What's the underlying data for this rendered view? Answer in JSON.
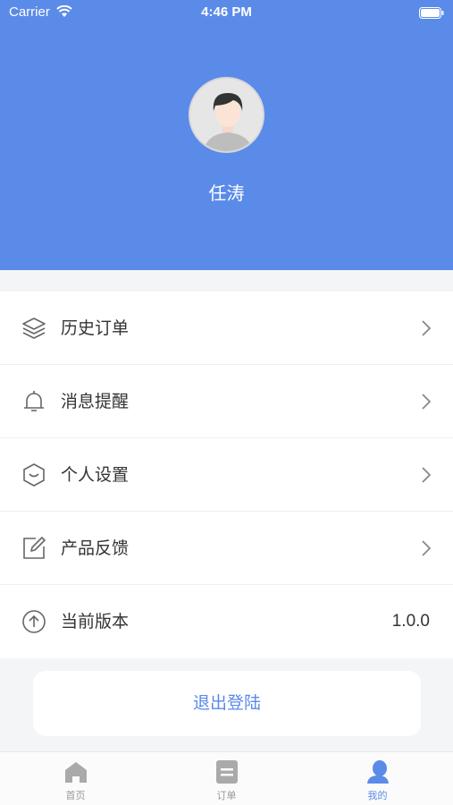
{
  "status_bar": {
    "carrier": "Carrier",
    "time": "4:46 PM"
  },
  "profile": {
    "name": "任涛"
  },
  "menu": [
    {
      "label": "历史订单",
      "icon": "layers-icon"
    },
    {
      "label": "消息提醒",
      "icon": "bell-icon"
    },
    {
      "label": "个人设置",
      "icon": "shield-icon"
    },
    {
      "label": "产品反馈",
      "icon": "edit-icon"
    },
    {
      "label": "当前版本",
      "icon": "arrow-up-circle-icon",
      "value": "1.0.0"
    }
  ],
  "logout": {
    "label": "退出登陆"
  },
  "tabbar": [
    {
      "label": "首页",
      "icon": "home-icon"
    },
    {
      "label": "订单",
      "icon": "order-icon"
    },
    {
      "label": "我的",
      "icon": "user-icon",
      "active": true
    }
  ],
  "colors": {
    "accent": "#5b8be8",
    "background": "#f4f5f7"
  }
}
